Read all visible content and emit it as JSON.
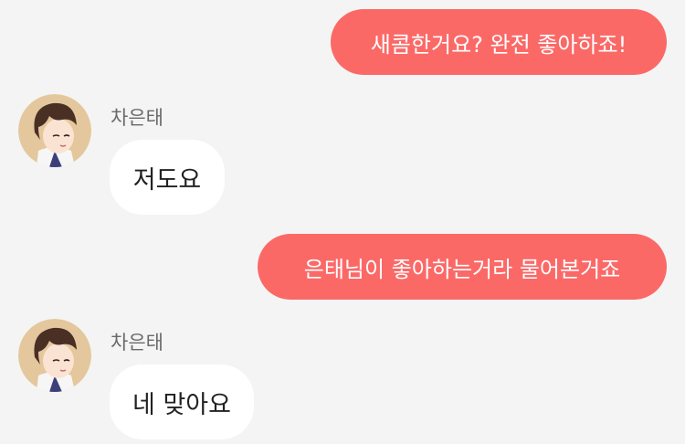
{
  "messages": [
    {
      "direction": "out",
      "text": "새콤한거요? 완전 좋아하죠!"
    },
    {
      "direction": "in",
      "sender": "차은태",
      "text": "저도요"
    },
    {
      "direction": "out",
      "text": "은태님이 좋아하는거라 물어본거죠"
    },
    {
      "direction": "in",
      "sender": "차은태",
      "text": "네 맞아요"
    }
  ],
  "colors": {
    "background": "#f4f4f4",
    "outgoing_bubble": "#fb6967",
    "incoming_bubble": "#ffffff",
    "sender_name": "#6a6a6a"
  },
  "icons": {
    "avatar": "avatar-icon"
  }
}
